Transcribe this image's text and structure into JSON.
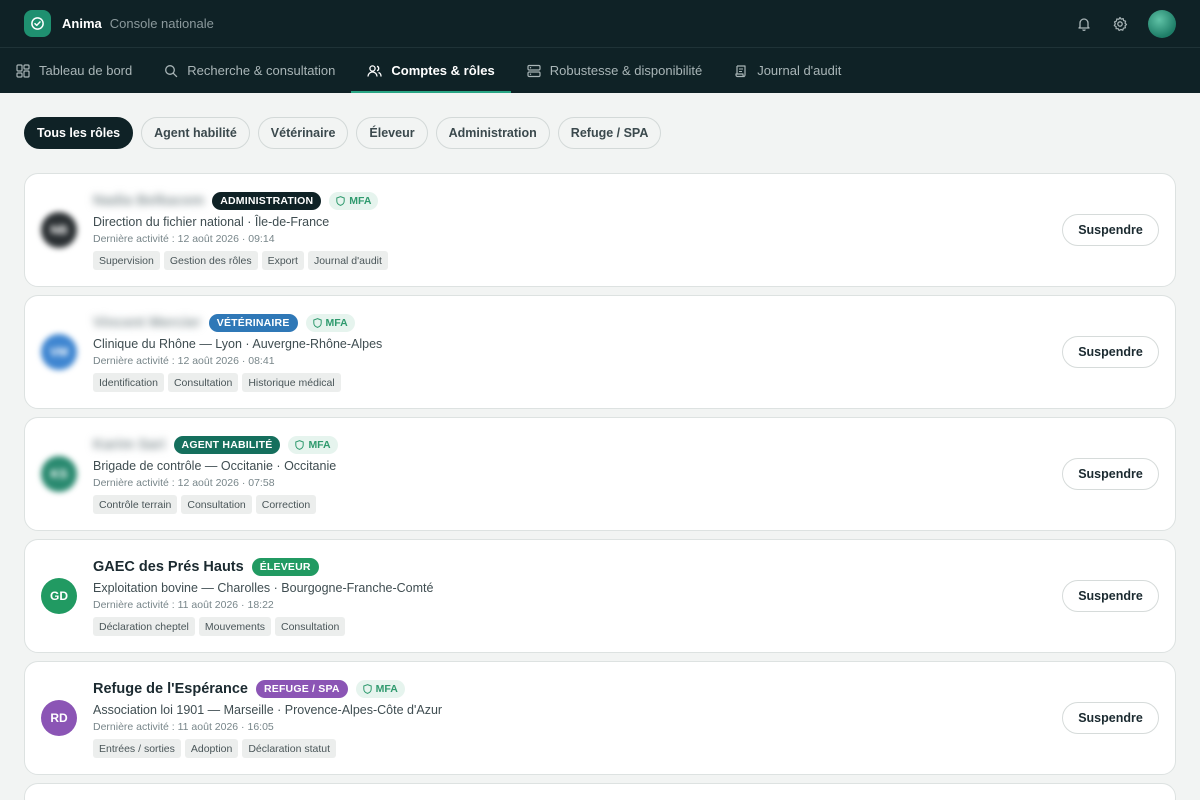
{
  "app": {
    "name": "Anima",
    "subtitle": "Console nationale"
  },
  "header_icons": [
    "bell-icon",
    "gear-icon",
    "user-avatar"
  ],
  "nav": [
    {
      "label": "Tableau de bord",
      "icon": "dashboard-icon",
      "active": false
    },
    {
      "label": "Recherche & consultation",
      "icon": "search-icon",
      "active": false
    },
    {
      "label": "Comptes & rôles",
      "icon": "users-icon",
      "active": true
    },
    {
      "label": "Robustesse & disponibilité",
      "icon": "server-icon",
      "active": false
    },
    {
      "label": "Journal d'audit",
      "icon": "scroll-icon",
      "active": false
    }
  ],
  "filters": [
    {
      "label": "Tous les rôles",
      "active": true
    },
    {
      "label": "Agent habilité",
      "active": false
    },
    {
      "label": "Vétérinaire",
      "active": false
    },
    {
      "label": "Éleveur",
      "active": false
    },
    {
      "label": "Administration",
      "active": false
    },
    {
      "label": "Refuge / SPA",
      "active": false
    }
  ],
  "colors": {
    "header_bg": "#0f2226",
    "accent": "#29a584",
    "administration": "#0f2226",
    "veterinaire": "#2f78b7",
    "agent": "#156f5d",
    "eleveur": "#219a62",
    "refuge": "#8b55b5",
    "mfa": "#2f9a6e"
  },
  "accounts": [
    {
      "name": "Nadia Belkacem",
      "name_blurred": true,
      "initials": "NB",
      "avatar_blurred": true,
      "avatar_color": "#2c3134",
      "role": "ADMINISTRATION",
      "role_color": "#0f2226",
      "mfa": "MFA",
      "org": "Direction du fichier national · Île-de-France",
      "activity": "Dernière activité : 12 août 2026 · 09:14",
      "permissions": [
        "Supervision",
        "Gestion des rôles",
        "Export",
        "Journal d'audit"
      ],
      "action": "Suspendre"
    },
    {
      "name": "Vincent Mercier",
      "name_blurred": true,
      "initials": "VM",
      "avatar_blurred": true,
      "avatar_color": "#3f86d1",
      "role": "VÉTÉRINAIRE",
      "role_color": "#2f78b7",
      "mfa": "MFA",
      "org": "Clinique du Rhône — Lyon · Auvergne-Rhône-Alpes",
      "activity": "Dernière activité : 12 août 2026 · 08:41",
      "permissions": [
        "Identification",
        "Consultation",
        "Historique médical"
      ],
      "action": "Suspendre"
    },
    {
      "name": "Karim Sari",
      "name_blurred": true,
      "initials": "KS",
      "avatar_blurred": true,
      "avatar_color": "#2a8a70",
      "role": "AGENT HABILITÉ",
      "role_color": "#156f5d",
      "mfa": "MFA",
      "org": "Brigade de contrôle — Occitanie · Occitanie",
      "activity": "Dernière activité : 12 août 2026 · 07:58",
      "permissions": [
        "Contrôle terrain",
        "Consultation",
        "Correction"
      ],
      "action": "Suspendre"
    },
    {
      "name": "GAEC des Prés Hauts",
      "name_blurred": false,
      "initials": "GD",
      "avatar_blurred": false,
      "avatar_color": "#219a62",
      "role": "ÉLEVEUR",
      "role_color": "#219a62",
      "mfa": "",
      "org": "Exploitation bovine — Charolles · Bourgogne-Franche-Comté",
      "activity": "Dernière activité : 11 août 2026 · 18:22",
      "permissions": [
        "Déclaration cheptel",
        "Mouvements",
        "Consultation"
      ],
      "action": "Suspendre"
    },
    {
      "name": "Refuge de l'Espérance",
      "name_blurred": false,
      "initials": "RD",
      "avatar_blurred": false,
      "avatar_color": "#8b55b5",
      "role": "REFUGE / SPA",
      "role_color": "#8b55b5",
      "mfa": "MFA",
      "org": "Association loi 1901 — Marseille · Provence-Alpes-Côte d'Azur",
      "activity": "Dernière activité : 11 août 2026 · 16:05",
      "permissions": [
        "Entrées / sorties",
        "Adoption",
        "Déclaration statut"
      ],
      "action": "Suspendre"
    }
  ]
}
